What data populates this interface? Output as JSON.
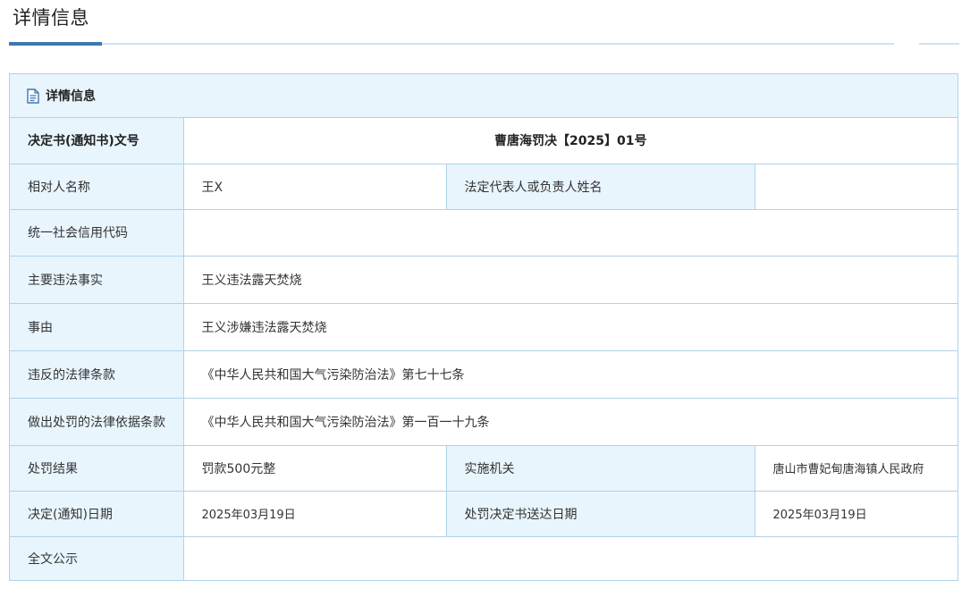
{
  "page": {
    "title": "详情信息"
  },
  "panel": {
    "title": "详情信息",
    "icon": "document-icon"
  },
  "rows": {
    "decision_no": {
      "label": "决定书(通知书)文号",
      "value": "曹唐海罚决【2025】01号"
    },
    "party_name": {
      "label": "相对人名称",
      "value": "王X"
    },
    "legal_rep": {
      "label": "法定代表人或负责人姓名",
      "value": ""
    },
    "credit_code": {
      "label": "统一社会信用代码",
      "value": ""
    },
    "main_facts": {
      "label": "主要违法事实",
      "value": "王义违法露天焚烧"
    },
    "cause": {
      "label": "事由",
      "value": "王义涉嫌违法露天焚烧"
    },
    "violated_law": {
      "label": "违反的法律条款",
      "value": "《中华人民共和国大气污染防治法》第七十七条"
    },
    "penalty_basis": {
      "label": "做出处罚的法律依据条款",
      "value": "《中华人民共和国大气污染防治法》第一百一十九条"
    },
    "penalty_result": {
      "label": "处罚结果",
      "value": "罚款500元整"
    },
    "agency": {
      "label": "实施机关",
      "value": "唐山市曹妃甸唐海镇人民政府"
    },
    "decision_date": {
      "label": "决定(通知)日期",
      "value": "2025年03月19日"
    },
    "delivery_date": {
      "label": "处罚决定书送达日期",
      "value": "2025年03月19日"
    },
    "full_text": {
      "label": "全文公示",
      "value": ""
    }
  },
  "colors": {
    "accent": "#3d78b0",
    "border": "#aed3e8",
    "label_bg": "#e8f5fd"
  }
}
